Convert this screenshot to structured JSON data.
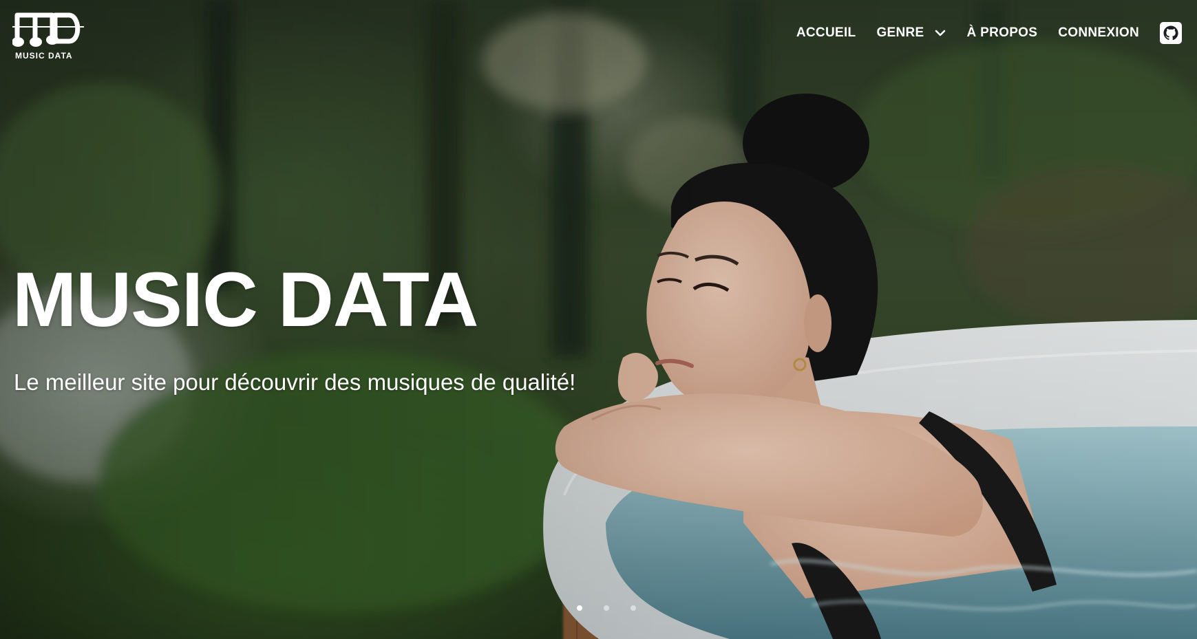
{
  "brand": {
    "logo_text": "MUSIC DATA"
  },
  "nav": {
    "items": [
      {
        "label": "ACCUEIL"
      },
      {
        "label": "GENRE",
        "has_dropdown": true
      },
      {
        "label": "À PROPOS"
      },
      {
        "label": "CONNEXION"
      }
    ],
    "github_icon": "github-icon"
  },
  "hero": {
    "title": "MUSIC DATA",
    "subtitle": "Le meilleur site pour découvrir des musiques de qualité!"
  },
  "carousel": {
    "slides": 3,
    "active_index": 0
  },
  "colors": {
    "text": "#ffffff",
    "water": "#9fc6cf",
    "tub": "#e9ecec"
  }
}
